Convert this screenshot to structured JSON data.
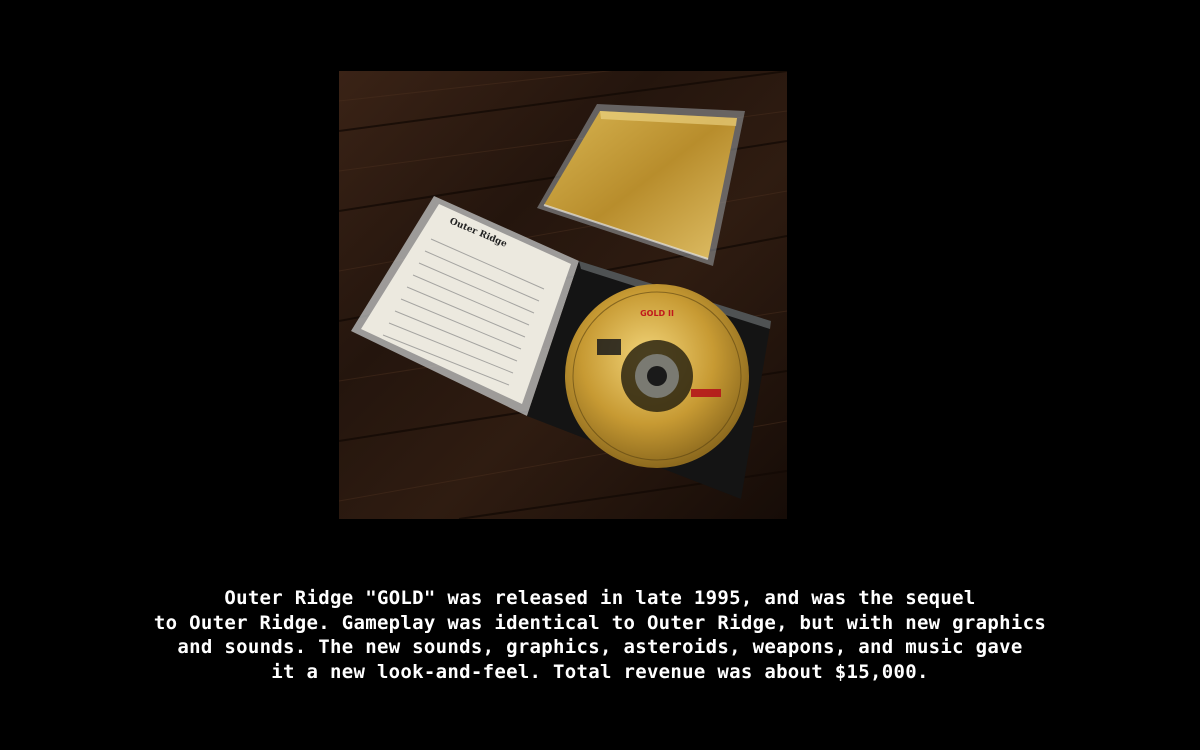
{
  "photo": {
    "booklet_title": "Outer Ridge",
    "disc_label_title": "GOLD II",
    "colors": {
      "background": "#000000",
      "gold": "#c9a23a",
      "wood_dark": "#2a1a10"
    }
  },
  "caption": {
    "lines": [
      "Outer Ridge \"GOLD\" was released in late 1995, and was the sequel",
      "to Outer Ridge. Gameplay was identical to Outer Ridge, but with new graphics",
      "and sounds. The new sounds, graphics, asteroids, weapons, and music gave",
      "it a new look-and-feel. Total revenue was about $15,000."
    ]
  }
}
